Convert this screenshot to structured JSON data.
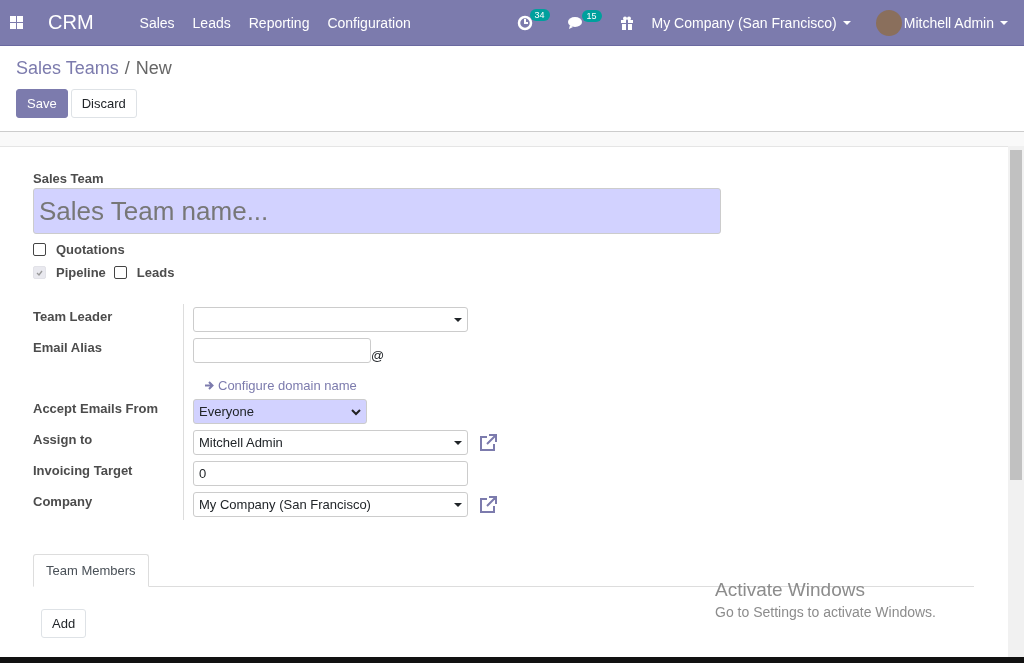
{
  "navbar": {
    "app_name": "CRM",
    "menus": [
      "Sales",
      "Leads",
      "Reporting",
      "Configuration"
    ],
    "activity_count": "34",
    "message_count": "15",
    "company": "My Company (San Francisco)",
    "user": "Mitchell Admin"
  },
  "breadcrumb": [
    "Sales Teams",
    "New"
  ],
  "breadcrumb_separator": "/",
  "buttons": {
    "save": "Save",
    "discard": "Discard"
  },
  "form": {
    "name_label": "Sales Team",
    "name_placeholder": "Sales Team name...",
    "option_rows": [
      [
        {
          "label": "Quotations",
          "checked": false,
          "disabled": false
        }
      ],
      [
        {
          "label": "Pipeline",
          "checked": true,
          "disabled": true
        },
        {
          "label": "Leads",
          "checked": false,
          "disabled": false
        }
      ]
    ],
    "fields": [
      {
        "kind": "many2one",
        "label": "Team Leader",
        "external_link": false
      },
      {
        "kind": "alias",
        "label": "Email Alias",
        "suffix": "@"
      },
      {
        "kind": "link",
        "text": "Configure domain name"
      },
      {
        "kind": "select",
        "label": "Accept Emails From",
        "value": "Everyone"
      },
      {
        "kind": "many2one",
        "label": "Assign to",
        "value": "Mitchell Admin",
        "external_link": true
      },
      {
        "kind": "char",
        "label": "Invoicing Target",
        "value": "0"
      },
      {
        "kind": "many2one",
        "label": "Company",
        "value": "My Company (San Francisco)",
        "external_link": true
      }
    ],
    "tabs": [
      {
        "label": "Team Members",
        "selected": true
      }
    ],
    "add_button": "Add"
  },
  "os_notice": {
    "title": "Activate Windows",
    "text": "Go to Settings to activate Windows."
  }
}
